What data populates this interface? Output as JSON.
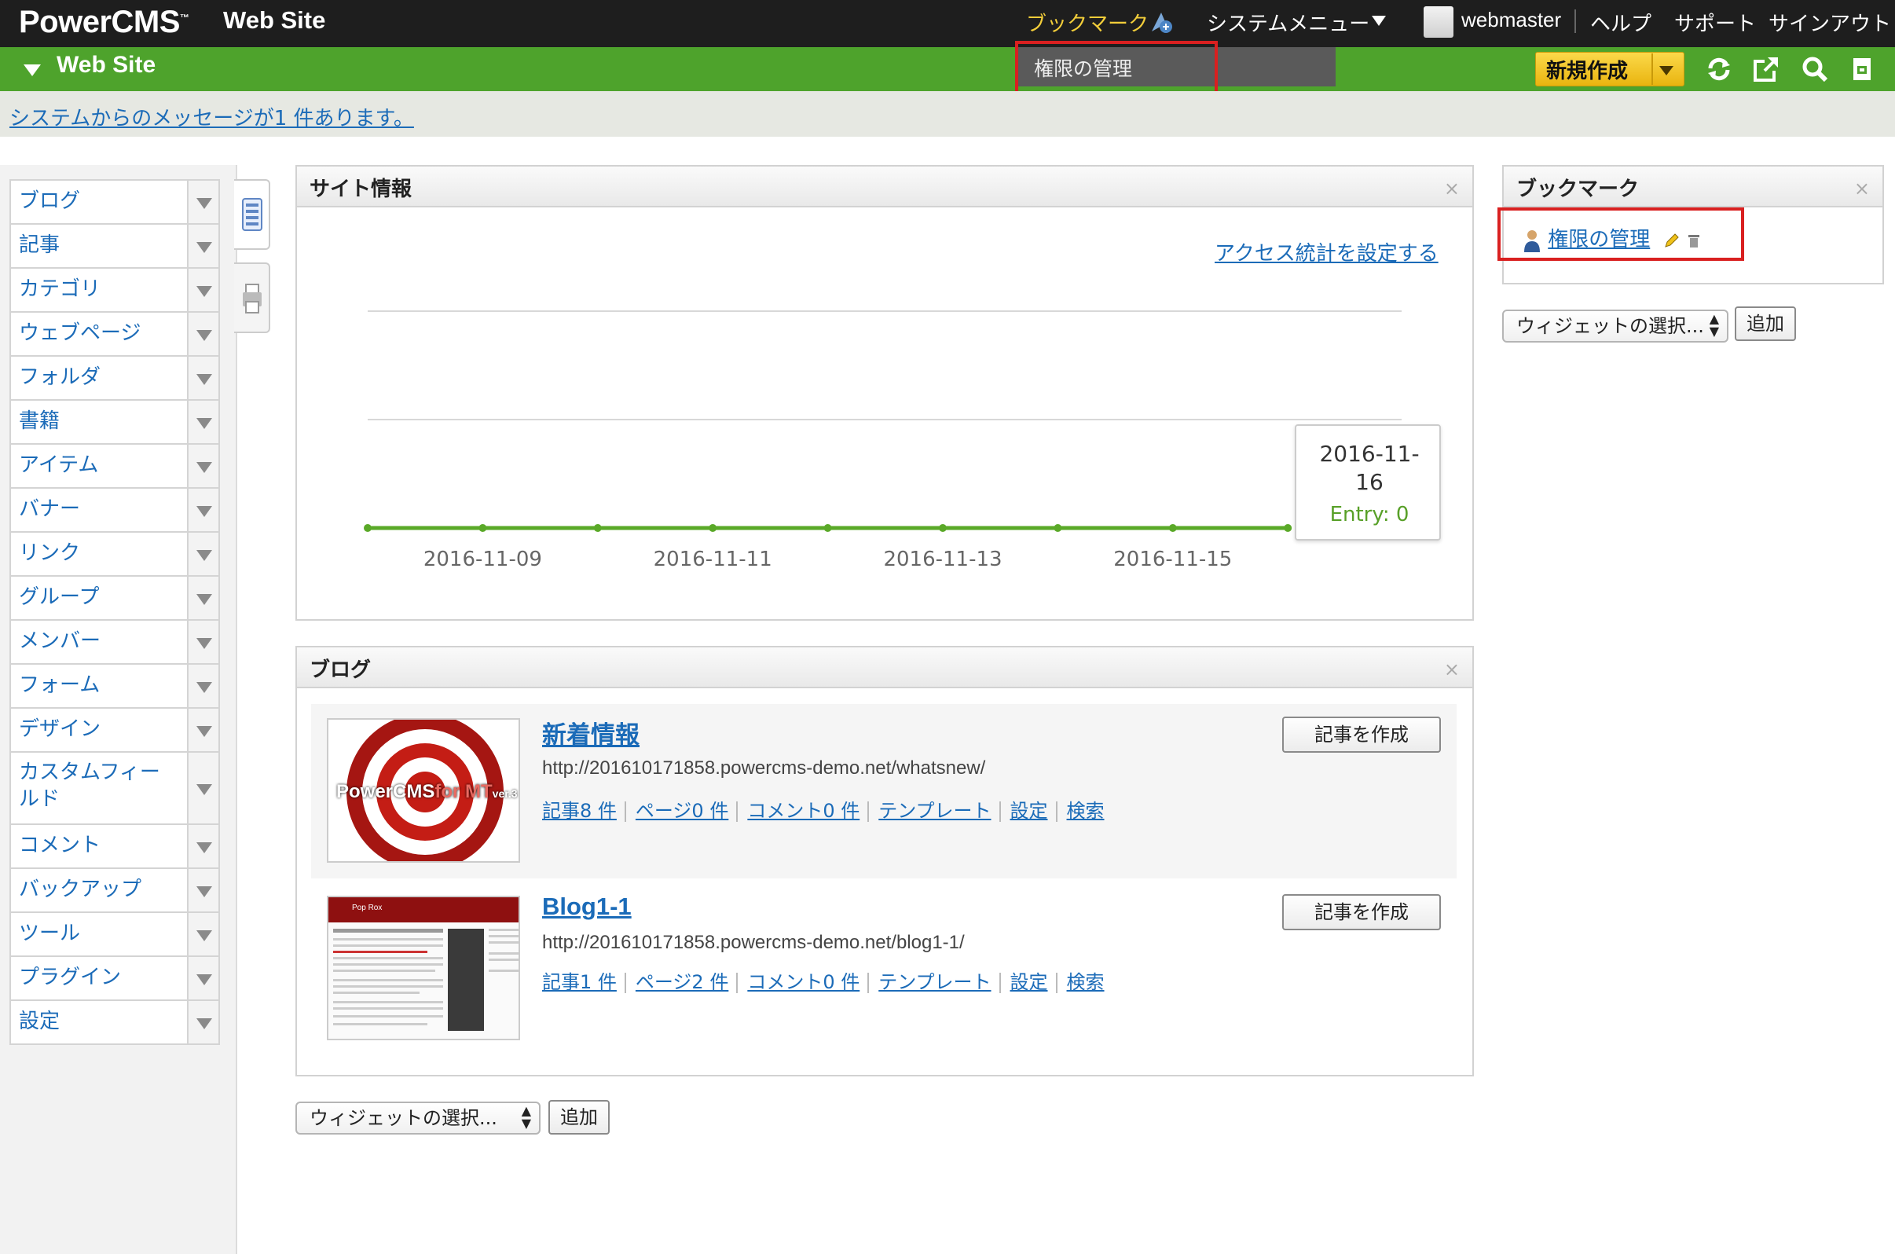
{
  "topbar": {
    "logo": "PowerCMS",
    "logo_tm": "™",
    "site": "Web Site",
    "bookmark": "ブックマーク",
    "system_menu": "システムメニュー",
    "user": "webmaster",
    "help": "ヘルプ",
    "support": "サポート",
    "signout": "サインアウト"
  },
  "bookmark_dropdown": {
    "item": "権限の管理"
  },
  "greenbar": {
    "title": "Web Site",
    "new_button": "新規作成"
  },
  "message": "システムからのメッセージが1 件あります。",
  "sidebar": {
    "items": [
      {
        "label": "ブログ"
      },
      {
        "label": "記事"
      },
      {
        "label": "カテゴリ"
      },
      {
        "label": "ウェブページ"
      },
      {
        "label": "フォルダ"
      },
      {
        "label": "書籍"
      },
      {
        "label": "アイテム"
      },
      {
        "label": "バナー"
      },
      {
        "label": "リンク"
      },
      {
        "label": "グループ"
      },
      {
        "label": "メンバー"
      },
      {
        "label": "フォーム"
      },
      {
        "label": "デザイン"
      },
      {
        "label": "カスタムフィールド",
        "line1": "カスタムフィー",
        "line2": "ルド"
      },
      {
        "label": "コメント"
      },
      {
        "label": "バックアップ"
      },
      {
        "label": "ツール"
      },
      {
        "label": "プラグイン"
      },
      {
        "label": "設定"
      }
    ]
  },
  "site_info": {
    "title": "サイト情報",
    "close": "×",
    "stats_link": "アクセス統計を設定する",
    "tooltip": {
      "date_line1": "2016-11-",
      "date_line2": "16",
      "entry": "Entry: 0"
    }
  },
  "chart_data": {
    "type": "line",
    "x": [
      "2016-11-08",
      "2016-11-09",
      "2016-11-10",
      "2016-11-11",
      "2016-11-12",
      "2016-11-13",
      "2016-11-14",
      "2016-11-15",
      "2016-11-16"
    ],
    "tick_labels": [
      "2016-11-09",
      "2016-11-11",
      "2016-11-13",
      "2016-11-15"
    ],
    "series": [
      {
        "name": "Entry",
        "values": [
          0,
          0,
          0,
          0,
          0,
          0,
          0,
          0,
          0
        ],
        "color": "#5aa928"
      }
    ],
    "grid": true
  },
  "blog_widget": {
    "title": "ブログ",
    "close": "×",
    "blogs": [
      {
        "name": "新着情報",
        "url": "http://201610171858.powercms-demo.net/whatsnew/",
        "links": [
          "記事8 件",
          "ページ0 件",
          "コメント0 件",
          "テンプレート",
          "設定",
          "検索"
        ],
        "create": "記事を作成",
        "thumb_text": "PowerCMS",
        "thumb_text2": "for MT",
        "thumb_ver": "ver.3"
      },
      {
        "name": "Blog1-1",
        "url": "http://201610171858.powercms-demo.net/blog1-1/",
        "links": [
          "記事1 件",
          "ページ2 件",
          "コメント0 件",
          "テンプレート",
          "設定",
          "検索"
        ],
        "create": "記事を作成",
        "thumb_text": "Pop Rox"
      }
    ]
  },
  "bookmark_widget": {
    "title": "ブックマーク",
    "close": "×",
    "item": "権限の管理"
  },
  "widget_select_main": {
    "value": "ウィジェットの選択...",
    "add": "追加"
  },
  "widget_select_right": {
    "value": "ウィジェットの選択...",
    "add": "追加"
  },
  "colors": {
    "topbar": "#1e1e1e",
    "green": "#4ea32c",
    "link": "#1b6bb8",
    "highlight": "#d92020",
    "new_button": "#f2c52a"
  }
}
